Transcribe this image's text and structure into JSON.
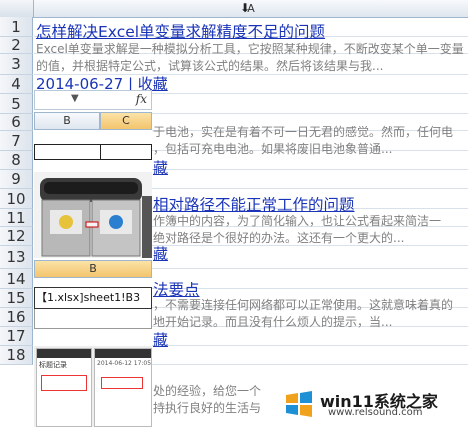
{
  "grid": {
    "column_label": "A",
    "rows": [
      "1",
      "2",
      "3",
      "4",
      "5",
      "6",
      "7",
      "8",
      "9",
      "10",
      "11",
      "12",
      "13",
      "14",
      "15",
      "16",
      "17",
      "18"
    ]
  },
  "articles": [
    {
      "title": "怎样解决Excel单变量求解精度不足的问题",
      "line1": "Excel单变量求解是一种模拟分析工具，它按照某种规律，不断改变某个单一变量",
      "line2": "的值，并根据特定公式，试算该公式的结果。然后将该结果与我...",
      "date": "2014-06-27",
      "separator": " | ",
      "tag": "收藏"
    },
    {
      "line1": "于电池，实在是有着不可一日无君的感觉。然而，任何电",
      "line2": "，包括可充电电池。如果将废旧电池象普通...",
      "tag": "藏"
    },
    {
      "title": "相对路径不能正常工作的问题",
      "line1": "作簿中的内容，为了简化输入，也让公式看起来简洁一",
      "line2": "绝对路径是个很好的办法。这还有一个更大的...",
      "tag": "藏"
    },
    {
      "title": "法要点",
      "line1": "，不需要连接任何网络都可以正常使用。这就意味着真的",
      "line2": "地开始记录。而且没有什么烦人的提示，当...",
      "tag": "藏"
    },
    {
      "line1": "处的经验，给您一个",
      "line2": "持执行良好的生活与"
    }
  ],
  "overlay_excel": {
    "fx_label": "fx",
    "col_b": "B",
    "col_c": "C"
  },
  "overlay_formula": {
    "col_label": "B",
    "cell_value": "【1.xlsx]sheet1!B3"
  },
  "overlay_phone": {
    "status": "2014-06-12 17:05:04",
    "app_title": "标题记录"
  },
  "watermark": {
    "brand": "win11系统之家",
    "url": "www.relsound.com"
  },
  "colors": {
    "link": "#1a34b8",
    "snippet": "#808080",
    "header_bg": "#dfe6ef",
    "selected_col": "#f3c46c"
  }
}
